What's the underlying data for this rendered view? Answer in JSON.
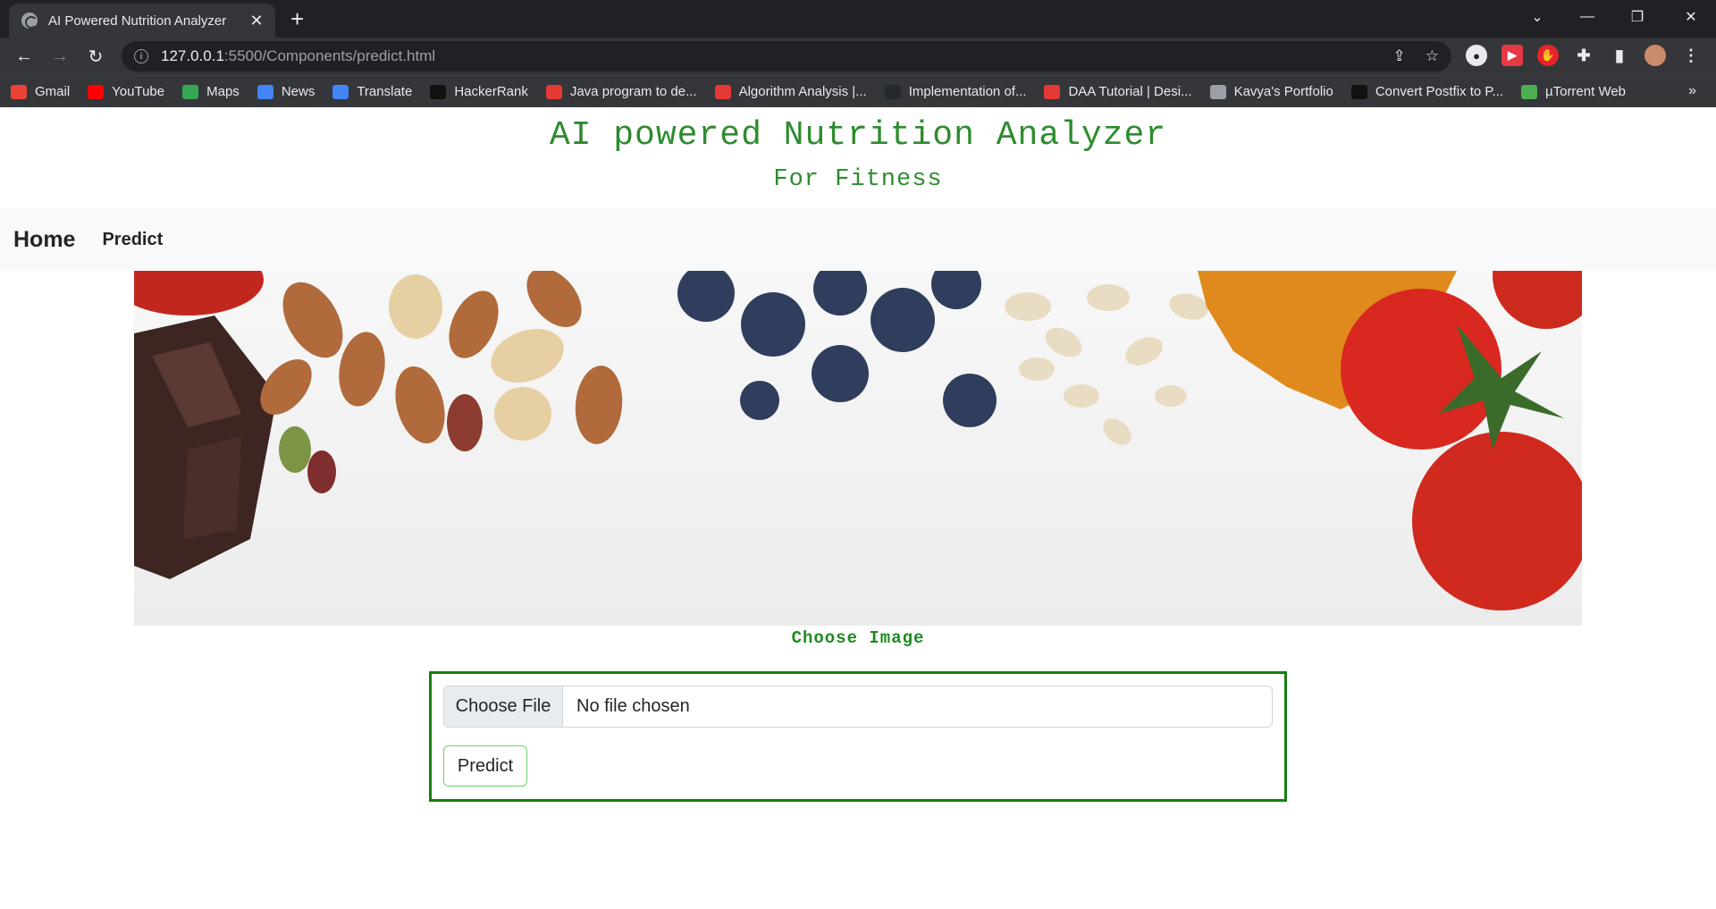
{
  "browser": {
    "tab_title": "AI Powered Nutrition Analyzer",
    "url_host": "127.0.0.1",
    "url_path": ":5500/Components/predict.html",
    "bookmarks": [
      {
        "label": "Gmail",
        "icon": "gmail-icon",
        "color": "#ea4335"
      },
      {
        "label": "YouTube",
        "icon": "youtube-icon",
        "color": "#ff0000"
      },
      {
        "label": "Maps",
        "icon": "maps-icon",
        "color": "#34a853"
      },
      {
        "label": "News",
        "icon": "news-icon",
        "color": "#4285f4"
      },
      {
        "label": "Translate",
        "icon": "translate-icon",
        "color": "#4285f4"
      },
      {
        "label": "HackerRank",
        "icon": "hackerrank-icon",
        "color": "#111111"
      },
      {
        "label": "Java program to de...",
        "icon": "v-logo-icon",
        "color": "#e53935"
      },
      {
        "label": "Algorithm Analysis |...",
        "icon": "bookmark-red-icon",
        "color": "#e53935"
      },
      {
        "label": "Implementation of...",
        "icon": "github-icon",
        "color": "#24292e"
      },
      {
        "label": "DAA Tutorial | Desi...",
        "icon": "v-logo-icon",
        "color": "#e53935"
      },
      {
        "label": "Kavya's Portfolio",
        "icon": "globe-icon",
        "color": "#9aa0a6"
      },
      {
        "label": "Convert Postfix to P...",
        "icon": "th-icon",
        "color": "#111111"
      },
      {
        "label": "µTorrent Web",
        "icon": "utorrent-icon",
        "color": "#4caf50"
      }
    ]
  },
  "page": {
    "title": "AI powered Nutrition Analyzer",
    "subtitle": "For Fitness",
    "nav": {
      "home": "Home",
      "predict": "Predict"
    },
    "choose_label": "Choose Image",
    "file_button": "Choose File",
    "file_status": "No file chosen",
    "predict_button": "Predict"
  },
  "colors": {
    "accent_green": "#2e8b2e",
    "form_border": "#138013"
  }
}
